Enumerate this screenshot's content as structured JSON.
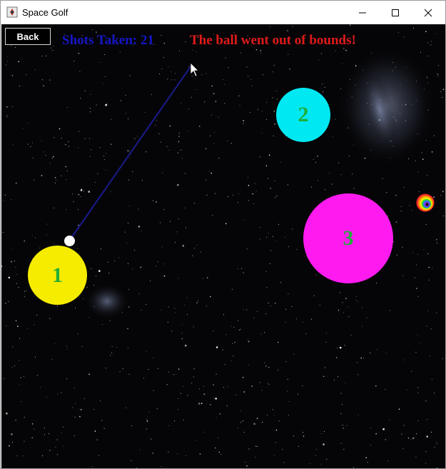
{
  "window": {
    "title": "Space Golf",
    "controls": [
      "minimize",
      "maximize",
      "close"
    ]
  },
  "game": {
    "back_label": "Back",
    "shots_label": "Shots Taken: 21",
    "status_message": "The ball went out of bounds!",
    "planets": [
      {
        "label": "1",
        "color": "#f6ec00"
      },
      {
        "label": "2",
        "color": "#00e8f2"
      },
      {
        "label": "3",
        "color": "#ff1bf0"
      }
    ],
    "ball_color": "#ffffff",
    "aim_line_color": "#1a1a8c",
    "hole_icon": "rainbow-hole-icon",
    "background": "starfield"
  },
  "colors": {
    "planet_number": "#1fae3a",
    "shots_text": "#1616c8",
    "status_text": "#e01a1a"
  }
}
